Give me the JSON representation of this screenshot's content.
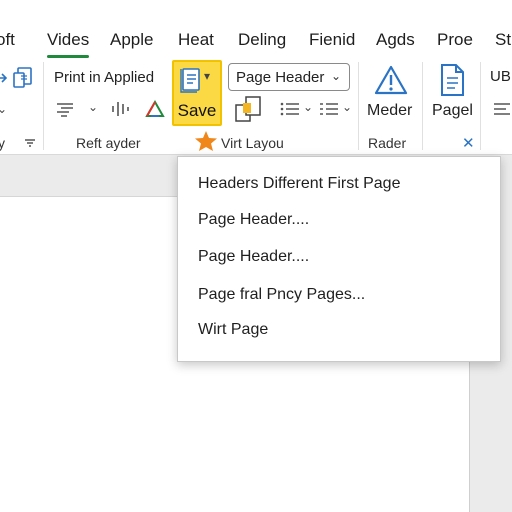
{
  "tabs": [
    {
      "label": "oft"
    },
    {
      "label": "Vides"
    },
    {
      "label": "Apple"
    },
    {
      "label": "Heat"
    },
    {
      "label": "Deling"
    },
    {
      "label": "Fienid"
    },
    {
      "label": "Agds"
    },
    {
      "label": "Proe"
    },
    {
      "label": "St"
    }
  ],
  "ribbon": {
    "print_applied": "Print in Applied",
    "save_label": "Save",
    "page_header_combo": "Page Header",
    "meder_label": "Meder",
    "pagel_label": "Pagel",
    "ub_label": "UB",
    "groups": {
      "left_fragment": "y",
      "reft_ayder": "Reft ayder",
      "virt_layou": "Virt Layou",
      "rader": "Rader"
    }
  },
  "menu": {
    "items": [
      {
        "label": "Headers Different First Page"
      },
      {
        "label": "Page Header...."
      },
      {
        "label": "Page Header...."
      },
      {
        "label": "Page fral Pncy Pages..."
      },
      {
        "label": "Wirt Page"
      }
    ]
  },
  "colors": {
    "active_tab_underline": "#1f8a3b",
    "save_highlight": "#fbd945",
    "icon_blue": "#2b73c4",
    "star_orange": "#f0871a"
  },
  "icons": [
    "copy-icon",
    "align-lines-icon",
    "vertical-bars-icon",
    "color-triangle-icon",
    "document-list-icon",
    "duplicate-pages-icon",
    "bullet-list-icon",
    "warning-triangle-icon",
    "document-icon",
    "star-icon",
    "close-icon"
  ]
}
